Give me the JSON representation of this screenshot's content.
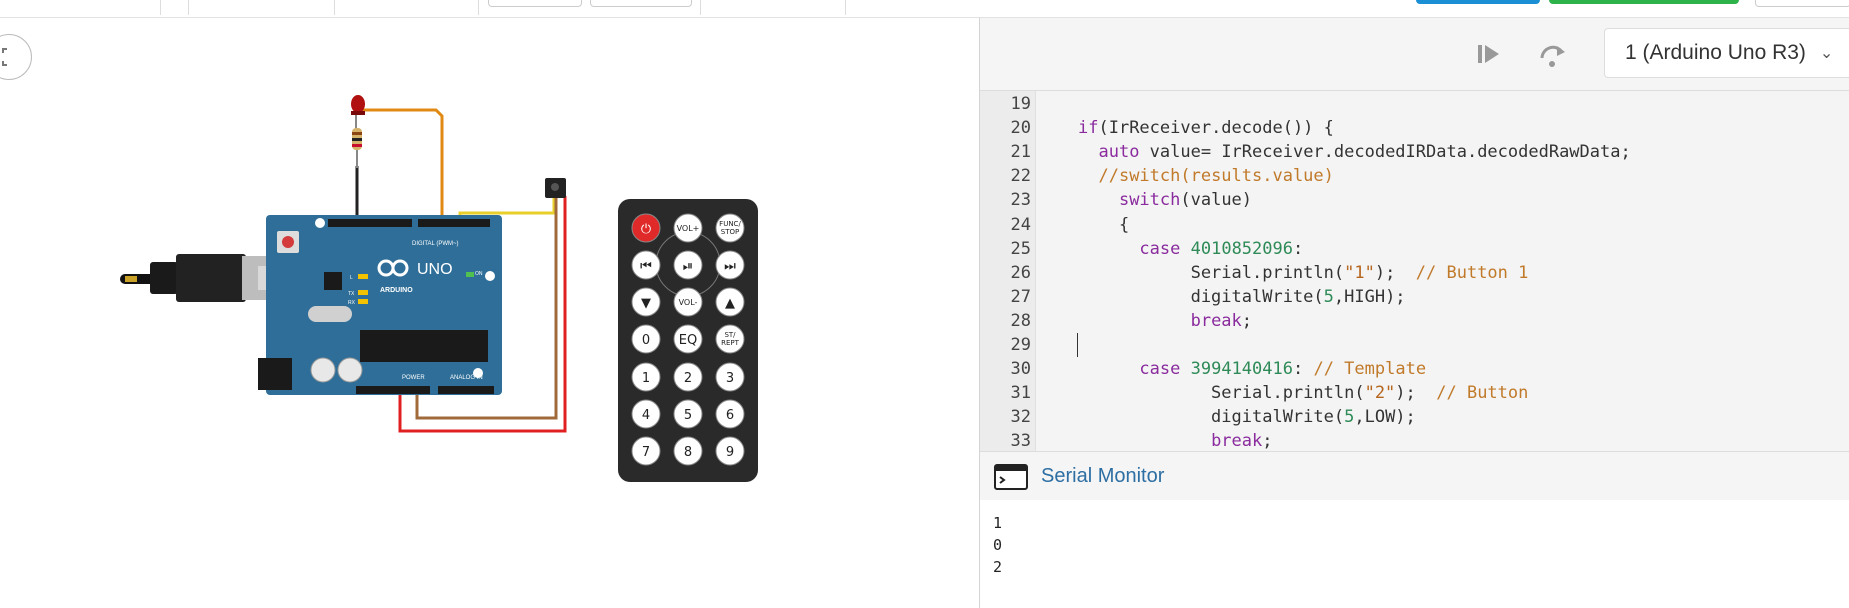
{
  "editor": {
    "lines": [
      {
        "n": "19",
        "tokens": []
      },
      {
        "n": "20",
        "tokens": [
          {
            "t": "if",
            "c": "kw"
          },
          {
            "t": "(IrReceiver.decode()) {",
            "c": ""
          }
        ]
      },
      {
        "n": "21",
        "tokens": [
          {
            "t": "  ",
            "c": ""
          },
          {
            "t": "auto",
            "c": "kw"
          },
          {
            "t": " value= IrReceiver.decodedIRData.decodedRawData;",
            "c": ""
          }
        ]
      },
      {
        "n": "22",
        "tokens": [
          {
            "t": "  ",
            "c": ""
          },
          {
            "t": "//switch(results.value)",
            "c": "cmt"
          }
        ]
      },
      {
        "n": "23",
        "tokens": [
          {
            "t": "    ",
            "c": ""
          },
          {
            "t": "switch",
            "c": "kw"
          },
          {
            "t": "(value)",
            "c": ""
          }
        ]
      },
      {
        "n": "24",
        "tokens": [
          {
            "t": "    {",
            "c": ""
          }
        ]
      },
      {
        "n": "25",
        "tokens": [
          {
            "t": "      ",
            "c": ""
          },
          {
            "t": "case",
            "c": "kw"
          },
          {
            "t": " ",
            "c": ""
          },
          {
            "t": "4010852096",
            "c": "num"
          },
          {
            "t": ":",
            "c": ""
          }
        ]
      },
      {
        "n": "26",
        "tokens": [
          {
            "t": "           Serial.println(",
            "c": ""
          },
          {
            "t": "\"1\"",
            "c": "str"
          },
          {
            "t": ");  ",
            "c": ""
          },
          {
            "t": "// Button 1",
            "c": "cmt"
          }
        ]
      },
      {
        "n": "27",
        "tokens": [
          {
            "t": "           digitalWrite(",
            "c": ""
          },
          {
            "t": "5",
            "c": "num"
          },
          {
            "t": ",HIGH);",
            "c": ""
          }
        ]
      },
      {
        "n": "28",
        "tokens": [
          {
            "t": "           ",
            "c": ""
          },
          {
            "t": "break",
            "c": "kw"
          },
          {
            "t": ";",
            "c": ""
          }
        ]
      },
      {
        "n": "29",
        "tokens": [],
        "caret": true
      },
      {
        "n": "30",
        "tokens": [
          {
            "t": "      ",
            "c": ""
          },
          {
            "t": "case",
            "c": "kw"
          },
          {
            "t": " ",
            "c": ""
          },
          {
            "t": "3994140416",
            "c": "num"
          },
          {
            "t": ": ",
            "c": ""
          },
          {
            "t": "// Template",
            "c": "cmt"
          }
        ]
      },
      {
        "n": "31",
        "tokens": [
          {
            "t": "             Serial.println(",
            "c": ""
          },
          {
            "t": "\"2\"",
            "c": "str"
          },
          {
            "t": ");  ",
            "c": ""
          },
          {
            "t": "// Button",
            "c": "cmt"
          }
        ]
      },
      {
        "n": "32",
        "tokens": [
          {
            "t": "             digitalWrite(",
            "c": ""
          },
          {
            "t": "5",
            "c": "num"
          },
          {
            "t": ",LOW);",
            "c": ""
          }
        ]
      },
      {
        "n": "33",
        "tokens": [
          {
            "t": "             ",
            "c": ""
          },
          {
            "t": "break",
            "c": "kw"
          },
          {
            "t": ";",
            "c": ""
          }
        ]
      }
    ]
  },
  "header": {
    "device": "1 (Arduino Uno R3)",
    "chevron": "⌄"
  },
  "serial_monitor": {
    "title": "Serial Monitor",
    "output": [
      "1",
      "0",
      "2"
    ]
  },
  "board": {
    "brand": "ARDUINO",
    "model": "UNO",
    "digital_label": "DIGITAL (PWM~)",
    "power_label": "POWER",
    "analog_label": "ANALOG IN",
    "on_label": "ON",
    "l_label": "L",
    "tx_label": "TX",
    "rx_label": "RX"
  },
  "remote": {
    "buttons": [
      {
        "label": "⏻",
        "name": "power",
        "red": true
      },
      {
        "label": "VOL+",
        "name": "vol-up"
      },
      {
        "label": "FUNC/\nSTOP",
        "name": "func-stop"
      },
      {
        "label": "⏮",
        "name": "rewind"
      },
      {
        "label": "⏯",
        "name": "play-pause"
      },
      {
        "label": "⏭",
        "name": "fast-forward"
      },
      {
        "label": "▼",
        "name": "down"
      },
      {
        "label": "VOL-",
        "name": "vol-down"
      },
      {
        "label": "▲",
        "name": "up"
      },
      {
        "label": "0",
        "name": "digit-0"
      },
      {
        "label": "EQ",
        "name": "eq"
      },
      {
        "label": "ST/\nREPT",
        "name": "st-rept"
      },
      {
        "label": "1",
        "name": "digit-1"
      },
      {
        "label": "2",
        "name": "digit-2"
      },
      {
        "label": "3",
        "name": "digit-3"
      },
      {
        "label": "4",
        "name": "digit-4"
      },
      {
        "label": "5",
        "name": "digit-5"
      },
      {
        "label": "6",
        "name": "digit-6"
      },
      {
        "label": "7",
        "name": "digit-7"
      },
      {
        "label": "8",
        "name": "digit-8"
      },
      {
        "label": "9",
        "name": "digit-9"
      }
    ]
  },
  "colors": {
    "accent_blue": "#1a8fd6",
    "accent_green": "#2db34a",
    "board_blue": "#2e6e98",
    "wire_orange": "#e08a14",
    "wire_red": "#e02020",
    "wire_brown": "#a06a3a",
    "wire_yellow": "#e8cf2a",
    "remote_red": "#e02a2a"
  }
}
